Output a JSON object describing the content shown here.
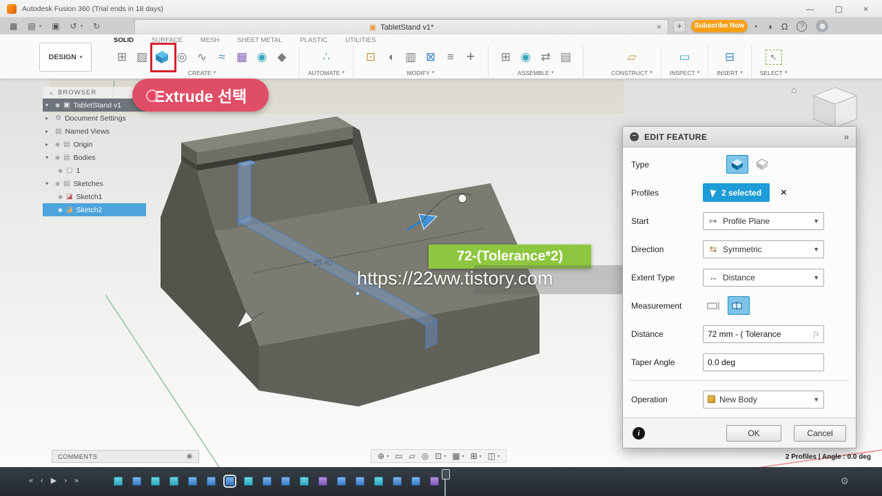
{
  "titlebar": {
    "title": "Autodesk Fusion 360 (Trial ends in 18 days)"
  },
  "tabbar": {
    "doc_tab": "TabletStand v1*",
    "subscribe_label": "Subscribe Now"
  },
  "ribbon": {
    "workspace_label": "DESIGN",
    "tabs": [
      {
        "label": "SOLID",
        "active": true
      },
      {
        "label": "SURFACE"
      },
      {
        "label": "MESH"
      },
      {
        "label": "SHEET METAL"
      },
      {
        "label": "PLASTIC"
      },
      {
        "label": "UTILITIES"
      }
    ],
    "groups": [
      {
        "label": "CREATE"
      },
      {
        "label": "AUTOMATE"
      },
      {
        "label": "MODIFY"
      },
      {
        "label": "ASSEMBLE"
      },
      {
        "label": "CONSTRUCT"
      },
      {
        "label": "INSPECT"
      },
      {
        "label": "INSERT"
      },
      {
        "label": "SELECT"
      }
    ]
  },
  "browser": {
    "header": "BROWSER",
    "items": [
      {
        "label": "TabletStand v1"
      },
      {
        "label": "Document Settings"
      },
      {
        "label": "Named Views"
      },
      {
        "label": "Origin"
      },
      {
        "label": "Bodies"
      },
      {
        "label": "1"
      },
      {
        "label": "Sketches"
      },
      {
        "label": "Sketch1"
      },
      {
        "label": "Sketch2"
      }
    ]
  },
  "annotations": {
    "callout_text": "Extrude 선택",
    "green_label": "72-(Tolerance*2)",
    "watermark": "https://22ww.tistory.com",
    "dimension": "35.40"
  },
  "dialog": {
    "title": "EDIT FEATURE",
    "type_label": "Type",
    "profiles_label": "Profiles",
    "profiles_value": "2 selected",
    "start_label": "Start",
    "start_value": "Profile Plane",
    "direction_label": "Direction",
    "direction_value": "Symmetric",
    "extent_label": "Extent Type",
    "extent_value": "Distance",
    "measurement_label": "Measurement",
    "distance_label": "Distance",
    "distance_value": "72 mm - ( Tolerance",
    "distance_fx": "fx",
    "taper_label": "Taper Angle",
    "taper_value": "0.0 deg",
    "operation_label": "Operation",
    "operation_value": "New Body",
    "ok_label": "OK",
    "cancel_label": "Cancel"
  },
  "statusbar": {
    "comments_label": "COMMENTS",
    "selection_info": "2 Profiles | Angle : 0.0 deg"
  },
  "colors": {
    "accent_blue": "#1e9cd8",
    "selection_blue": "#4da4dc",
    "highlight_red": "#d3202a",
    "callout_red": "#e04e66",
    "label_green": "#8dc63f",
    "subscribe_orange": "#f6a01a"
  }
}
